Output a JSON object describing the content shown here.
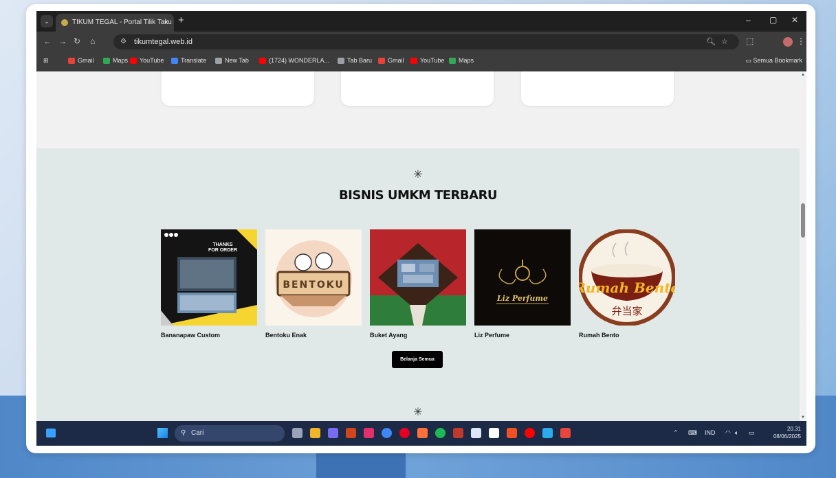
{
  "browser": {
    "tab_title": "TIKUM TEGAL - Portal Tilik Taku",
    "tab_close": "×",
    "new_tab": "+",
    "url": "tikumtegal.web.id",
    "window_controls": {
      "minimize": "–",
      "restore": "▢",
      "close": "✕"
    }
  },
  "bookmarks": {
    "items": [
      {
        "label": "Gmail",
        "icon": "gmail-icon",
        "color": "#e94235"
      },
      {
        "label": "Maps",
        "icon": "maps-icon",
        "color": "#34a853"
      },
      {
        "label": "YouTube",
        "icon": "youtube-icon",
        "color": "#ff0000"
      },
      {
        "label": "Translate",
        "icon": "translate-icon",
        "color": "#4285f4"
      },
      {
        "label": "New Tab",
        "icon": "chrome-icon",
        "color": "#9aa0a6"
      },
      {
        "label": "(1724) WONDERLA...",
        "icon": "youtube-icon",
        "color": "#ff0000"
      },
      {
        "label": "Tab Baru",
        "icon": "chrome-icon",
        "color": "#9aa0a6"
      },
      {
        "label": "Gmail",
        "icon": "gmail-icon",
        "color": "#e94235"
      },
      {
        "label": "YouTube",
        "icon": "youtube-icon",
        "color": "#ff0000"
      },
      {
        "label": "Maps",
        "icon": "maps-icon",
        "color": "#34a853"
      }
    ],
    "all_bookmarks": "Semua Bookmark"
  },
  "section": {
    "star": "✳",
    "title": "BISNIS UMKM TERBARU",
    "products": [
      {
        "name": "Bananapaw Custom",
        "thumb_text_1": "THANKS",
        "thumb_text_2": "FOR ORDER"
      },
      {
        "name": "Bentoku Enak",
        "thumb_text_1": "BENTOKU"
      },
      {
        "name": "Buket Ayang"
      },
      {
        "name": "Liz Perfume",
        "thumb_text_1": "Liz Perfume"
      },
      {
        "name": "Rumah Bento",
        "thumb_text_1": "Rumah Bento",
        "thumb_text_2": "弁当家"
      }
    ],
    "button_label": "Belanja Semua",
    "bottom_star": "✳"
  },
  "taskbar": {
    "search_placeholder": "Cari",
    "language": "IND",
    "time": "20.31",
    "date": "08/06/2025",
    "app_colors": [
      "#9aa4b8",
      "#f0b429",
      "#7a6cf0",
      "#d0451b",
      "#e1306c",
      "#4285f4",
      "#e60023",
      "#ff7139",
      "#1db954",
      "#c0392b",
      "#dfe6f5",
      "#ffffff",
      "#f25022",
      "#ff0000",
      "#2aabee",
      "#e8453c"
    ]
  }
}
